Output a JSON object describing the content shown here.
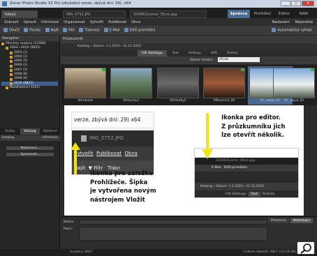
{
  "window": {
    "title": "Zoner Photo Studio 15 Pro (zkušební verze, zbývá dní: 29), x64",
    "min": "_",
    "max": "□",
    "close": "✕"
  },
  "doc_tabs": [
    "fotos1",
    "IMG_0752.JPG",
    "3264621zoner_05cm.jpg"
  ],
  "mode_tabs": [
    "Správce",
    "Prohlížeč",
    "Editor",
    "RAW"
  ],
  "menu": {
    "items": [
      "Zobrazit",
      "Upravit",
      "Informace",
      "Organizovat",
      "Vytvořit",
      "Publikovat",
      "Okna"
    ],
    "right": [
      "Nastavení",
      "Nápověda"
    ]
  },
  "toolbar": {
    "items": [
      "Otočit",
      "Panely",
      "Najít",
      "Filtr",
      "Tisknout",
      "E-Mail",
      "DVD promítání"
    ],
    "right": [
      "Automatický vyhlaš."
    ]
  },
  "left_panel": {
    "header": "Navigator",
    "tree": [
      {
        "label": "Všechny soubory (11566)",
        "depth": 0
      },
      {
        "label": "2003—2010 (9825)",
        "depth": 1
      },
      {
        "label": "2003 (1)",
        "depth": 2
      },
      {
        "label": "2004 (1)",
        "depth": 2
      },
      {
        "label": "2005 (5)",
        "depth": 2
      },
      {
        "label": "2006 (2)",
        "depth": 2
      },
      {
        "label": "2007 (5)",
        "depth": 2
      },
      {
        "label": "2008 (8)",
        "depth": 2
      },
      {
        "label": "2009 (6)",
        "depth": 2
      },
      {
        "label": "2010 (9827)",
        "depth": 2,
        "selected": true
      },
      {
        "label": "Nezařazeno (1241)",
        "depth": 1
      }
    ],
    "tabs": [
      "Složky",
      "Katalog",
      "Oblíbené"
    ],
    "section1": "Katalog",
    "section1_right": "Informace",
    "buttons": [
      "Nastavení...",
      "Spravovat..."
    ]
  },
  "browser": {
    "header": "Průzkumník",
    "path": "Katalog • Datum: 1.1.2010—31.12.2010",
    "filter_tabs": [
      "Filtr Katalogu",
      "Text",
      "Atributy",
      "GPS",
      "Známý"
    ],
    "area_label": "Oblast hledání:",
    "area_value": "Všude",
    "thumbnails": [
      "00rebuild",
      "00skutky1",
      "00skutky2",
      "00koncert_00",
      "01_nepal_01",
      "01_nepal_02"
    ]
  },
  "overlay": {
    "a_title_line": "verze, zbývá dní: 29) x64",
    "a_tab": "IMG_0752.JPG",
    "a_menu": [
      "Vytvořit",
      "Publikovat",
      "Okna"
    ],
    "a_toolbar": [
      "Najít",
      "Filtr",
      "Tiskn"
    ],
    "caption_a": [
      "Ikonka pro záložku",
      "Prohlížeče. Šipka",
      "je vytvořena novým",
      "nástrojem Vložit"
    ],
    "caption_b": [
      "Ikonka pro editor.",
      "Z průzkumníku jich",
      "lze otevřít několik."
    ],
    "b_tab": "3264621zoner_05cm.jpg",
    "b_toolbar": [
      "E-Mail",
      "DVD promítání"
    ],
    "b_path": "Katalog • Datum: 1.1.2010—31.12.2010",
    "b_tabs": [
      "Filtr Katalogu",
      "Text",
      "Atributy"
    ]
  },
  "bottom": {
    "label1": "Název:",
    "label2": "Popis:",
    "tabs": [
      "Předchozí",
      "Následující"
    ]
  },
  "status": {
    "left": "Soubory: 9827",
    "right": "Celkem objektů: 9827 (14.19 GB)"
  }
}
